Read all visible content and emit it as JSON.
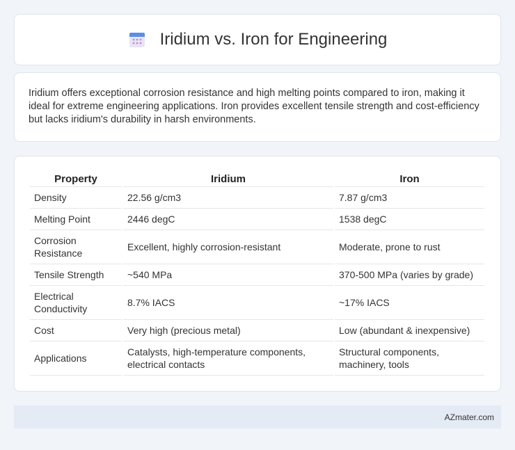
{
  "header": {
    "title": "Iridium vs. Iron for Engineering",
    "icon": "calendar-icon"
  },
  "summary": {
    "text": "Iridium offers exceptional corrosion resistance and high melting points compared to iron, making it ideal for extreme engineering applications. Iron provides excellent tensile strength and cost-efficiency but lacks iridium's durability in harsh environments."
  },
  "table": {
    "headers": [
      "Property",
      "Iridium",
      "Iron"
    ],
    "rows": [
      {
        "property": "Density",
        "iridium": "22.56 g/cm3",
        "iron": "7.87 g/cm3"
      },
      {
        "property": "Melting Point",
        "iridium": "2446 degC",
        "iron": "1538 degC"
      },
      {
        "property": "Corrosion Resistance",
        "iridium": "Excellent, highly corrosion-resistant",
        "iron": "Moderate, prone to rust"
      },
      {
        "property": "Tensile Strength",
        "iridium": "~540 MPa",
        "iron": "370-500 MPa (varies by grade)"
      },
      {
        "property": "Electrical Conductivity",
        "iridium": "8.7% IACS",
        "iron": "~17% IACS"
      },
      {
        "property": "Cost",
        "iridium": "Very high (precious metal)",
        "iron": "Low (abundant & inexpensive)"
      },
      {
        "property": "Applications",
        "iridium": "Catalysts, high-temperature components, electrical contacts",
        "iron": "Structural components, machinery, tools"
      }
    ]
  },
  "footer": {
    "text": "AZmater.com"
  }
}
